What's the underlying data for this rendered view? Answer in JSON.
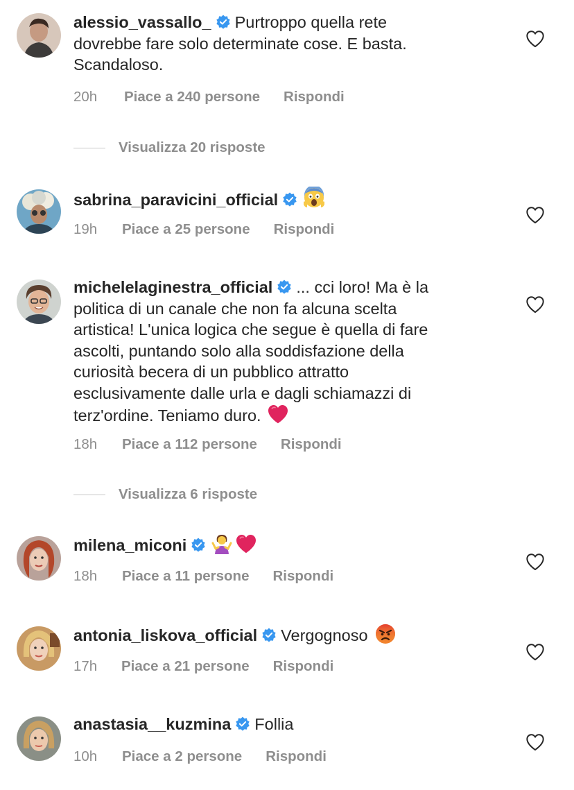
{
  "comments": [
    {
      "username": "alessio_vassallo_",
      "text_lines": [
        "Purtroppo quella rete",
        "dovrebbe fare solo determinate cose. E basta.",
        "Scandaloso."
      ],
      "time": "20h",
      "likes": "Piace a 240 persone",
      "reply": "Rispondi",
      "view_replies": "Visualizza 20 risposte"
    },
    {
      "username": "sabrina_paravicini_official",
      "emoji": "fear-scream-emoji",
      "time": "19h",
      "likes": "Piace a 25 persone",
      "reply": "Rispondi"
    },
    {
      "username": "michelelaginestra_official",
      "text_lines": [
        "... cci loro! Ma è la",
        "politica di un canale che non fa alcuna scelta",
        "artistica! L'unica logica che segue è quella di fare",
        "ascolti, puntando solo alla soddisfazione della",
        "curiosità becera di un pubblico attratto",
        "esclusivamente dalle urla e dagli schiamazzi di",
        "terz'ordine. Teniamo duro."
      ],
      "emoji": "red-heart-emoji",
      "time": "18h",
      "likes": "Piace a 112 persone",
      "reply": "Rispondi",
      "view_replies": "Visualizza 6 risposte"
    },
    {
      "username": "milena_miconi",
      "emoji": "shrug-woman-emoji, red-heart-emoji",
      "time": "18h",
      "likes": "Piace a 11 persone",
      "reply": "Rispondi"
    },
    {
      "username": "antonia_liskova_official",
      "text": "Vergognoso",
      "emoji": "angry-face-emoji",
      "time": "17h",
      "likes": "Piace a 21 persone",
      "reply": "Rispondi"
    },
    {
      "username": "anastasia__kuzmina",
      "text": "Follia",
      "time": "10h",
      "likes": "Piace a 2 persone",
      "reply": "Rispondi"
    }
  ],
  "colors": {
    "text": "#262626",
    "meta": "#8e8e8e",
    "verified": "#3897f0",
    "heart_red": "#e0245e"
  }
}
